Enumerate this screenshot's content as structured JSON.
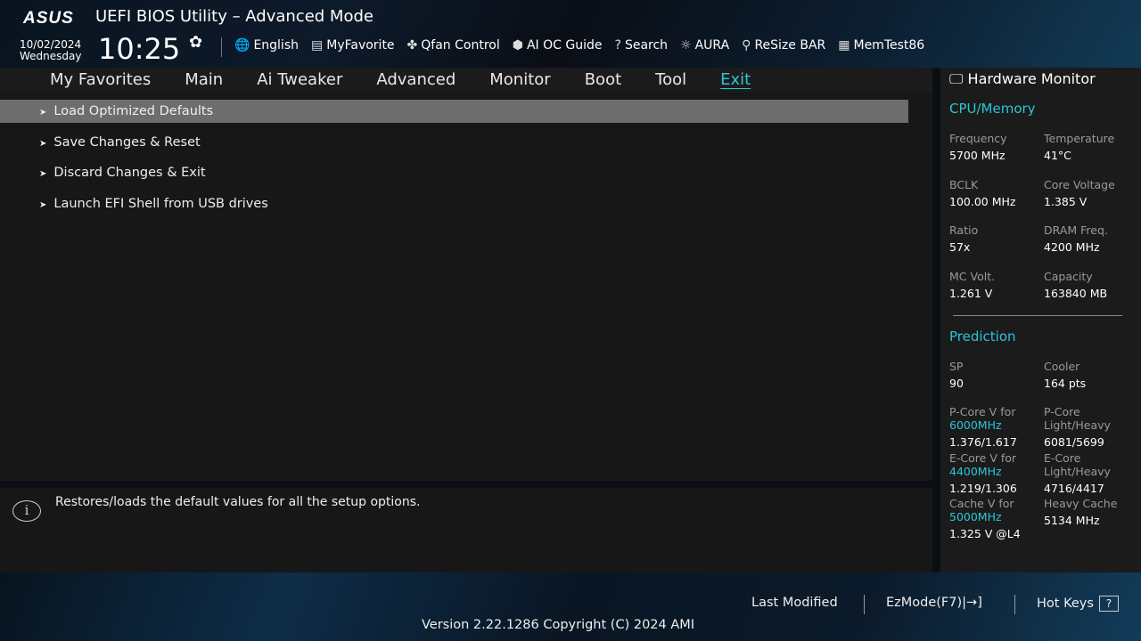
{
  "header": {
    "logo": "/ISUS",
    "title": "UEFI BIOS Utility – Advanced Mode",
    "date": "10/02/2024",
    "day": "Wednesday",
    "time": "10:25",
    "tools": [
      {
        "icon": "globe-icon",
        "glyph": "🌐",
        "label": "English"
      },
      {
        "icon": "favorite-icon",
        "glyph": "▤",
        "label": "MyFavorite"
      },
      {
        "icon": "fan-icon",
        "glyph": "✤",
        "label": "Qfan Control"
      },
      {
        "icon": "chip-icon",
        "glyph": "⬢",
        "label": "AI OC Guide"
      },
      {
        "icon": "search-icon",
        "glyph": "?",
        "label": "Search"
      },
      {
        "icon": "aura-icon",
        "glyph": "☼",
        "label": "AURA"
      },
      {
        "icon": "resize-bar-icon",
        "glyph": "⚲",
        "label": "ReSize BAR"
      },
      {
        "icon": "memtest-icon",
        "glyph": "▦",
        "label": "MemTest86"
      }
    ]
  },
  "tabs": [
    "My Favorites",
    "Main",
    "Ai Tweaker",
    "Advanced",
    "Monitor",
    "Boot",
    "Tool",
    "Exit"
  ],
  "menu": [
    "Load Optimized Defaults",
    "Save Changes & Reset",
    "Discard Changes & Exit",
    "Launch EFI Shell from USB drives"
  ],
  "help": "Restores/loads the default values for all the setup options.",
  "hw": {
    "title": "Hardware Monitor",
    "cpu_title": "CPU/Memory",
    "cpu": [
      [
        "Frequency",
        "5700 MHz"
      ],
      [
        "Temperature",
        "41°C"
      ],
      [
        "BCLK",
        "100.00 MHz"
      ],
      [
        "Core Voltage",
        "1.385 V"
      ],
      [
        "Ratio",
        "57x"
      ],
      [
        "DRAM Freq.",
        "4200 MHz"
      ],
      [
        "MC Volt.",
        "1.261 V"
      ],
      [
        "Capacity",
        "163840 MB"
      ]
    ],
    "pred_title": "Prediction",
    "sp": [
      "SP",
      "90"
    ],
    "cooler": [
      "Cooler",
      "164 pts"
    ],
    "pred": [
      {
        "l1": "P-Core V for",
        "f": "6000MHz",
        "v": "1.376/1.617",
        "r1": "P-Core",
        "r2": "Light/Heavy",
        "rv": "6081/5699"
      },
      {
        "l1": "E-Core V for",
        "f": "4400MHz",
        "v": "1.219/1.306",
        "r1": "E-Core",
        "r2": "Light/Heavy",
        "rv": "4716/4417"
      },
      {
        "l1": "Cache V for",
        "f": "5000MHz",
        "v": "1.325 V @L4",
        "r1": "Heavy Cache",
        "r2": "",
        "rv": "5134 MHz"
      }
    ]
  },
  "footer": {
    "last_modified": "Last Modified",
    "ezmode": "EzMode(F7)|→]",
    "hotkeys": "Hot Keys",
    "hotkeys_key": "?",
    "version": "Version 2.22.1286 Copyright (C) 2024 AMI"
  }
}
